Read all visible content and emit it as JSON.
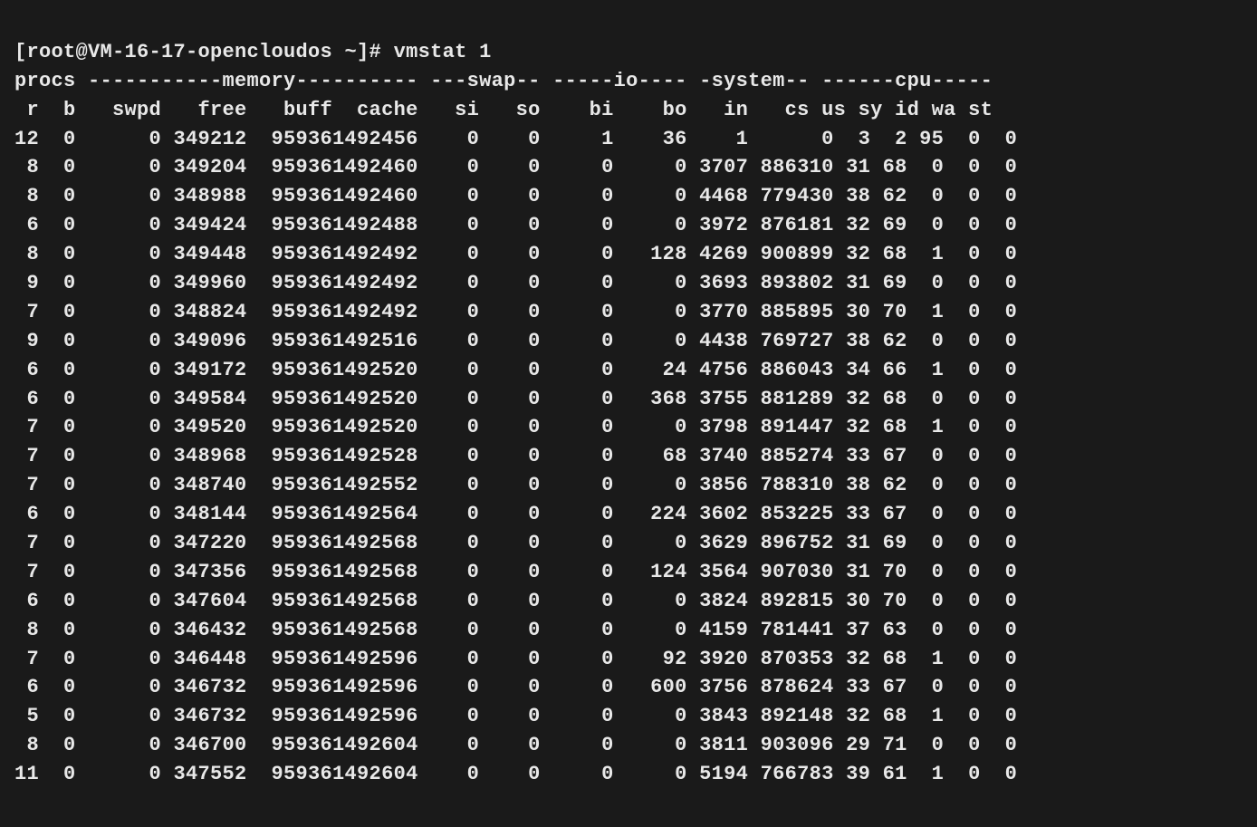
{
  "prompt": "[root@VM-16-17-opencloudos ~]# ",
  "command": "vmstat 1",
  "header1": "procs -----------memory---------- ---swap-- -----io---- -system-- ------cpu-----",
  "header2": " r  b   swpd   free   buff  cache   si   so    bi    bo   in   cs us sy id wa st",
  "rows": [
    {
      "r": "12",
      "b": "0",
      "swpd": "0",
      "free": "349212",
      "buff": "95936",
      "cache": "1492456",
      "si": "0",
      "so": "0",
      "bi": "1",
      "bo": "36",
      "in": "1",
      "cs": "0",
      "us": "3",
      "sy": "2",
      "id": "95",
      "wa": "0",
      "st": "0"
    },
    {
      "r": "8",
      "b": "0",
      "swpd": "0",
      "free": "349204",
      "buff": "95936",
      "cache": "1492460",
      "si": "0",
      "so": "0",
      "bi": "0",
      "bo": "0",
      "in": "3707",
      "cs": "886310",
      "us": "31",
      "sy": "68",
      "id": "0",
      "wa": "0",
      "st": "0"
    },
    {
      "r": "8",
      "b": "0",
      "swpd": "0",
      "free": "348988",
      "buff": "95936",
      "cache": "1492460",
      "si": "0",
      "so": "0",
      "bi": "0",
      "bo": "0",
      "in": "4468",
      "cs": "779430",
      "us": "38",
      "sy": "62",
      "id": "0",
      "wa": "0",
      "st": "0"
    },
    {
      "r": "6",
      "b": "0",
      "swpd": "0",
      "free": "349424",
      "buff": "95936",
      "cache": "1492488",
      "si": "0",
      "so": "0",
      "bi": "0",
      "bo": "0",
      "in": "3972",
      "cs": "876181",
      "us": "32",
      "sy": "69",
      "id": "0",
      "wa": "0",
      "st": "0"
    },
    {
      "r": "8",
      "b": "0",
      "swpd": "0",
      "free": "349448",
      "buff": "95936",
      "cache": "1492492",
      "si": "0",
      "so": "0",
      "bi": "0",
      "bo": "128",
      "in": "4269",
      "cs": "900899",
      "us": "32",
      "sy": "68",
      "id": "1",
      "wa": "0",
      "st": "0"
    },
    {
      "r": "9",
      "b": "0",
      "swpd": "0",
      "free": "349960",
      "buff": "95936",
      "cache": "1492492",
      "si": "0",
      "so": "0",
      "bi": "0",
      "bo": "0",
      "in": "3693",
      "cs": "893802",
      "us": "31",
      "sy": "69",
      "id": "0",
      "wa": "0",
      "st": "0"
    },
    {
      "r": "7",
      "b": "0",
      "swpd": "0",
      "free": "348824",
      "buff": "95936",
      "cache": "1492492",
      "si": "0",
      "so": "0",
      "bi": "0",
      "bo": "0",
      "in": "3770",
      "cs": "885895",
      "us": "30",
      "sy": "70",
      "id": "1",
      "wa": "0",
      "st": "0"
    },
    {
      "r": "9",
      "b": "0",
      "swpd": "0",
      "free": "349096",
      "buff": "95936",
      "cache": "1492516",
      "si": "0",
      "so": "0",
      "bi": "0",
      "bo": "0",
      "in": "4438",
      "cs": "769727",
      "us": "38",
      "sy": "62",
      "id": "0",
      "wa": "0",
      "st": "0"
    },
    {
      "r": "6",
      "b": "0",
      "swpd": "0",
      "free": "349172",
      "buff": "95936",
      "cache": "1492520",
      "si": "0",
      "so": "0",
      "bi": "0",
      "bo": "24",
      "in": "4756",
      "cs": "886043",
      "us": "34",
      "sy": "66",
      "id": "1",
      "wa": "0",
      "st": "0"
    },
    {
      "r": "6",
      "b": "0",
      "swpd": "0",
      "free": "349584",
      "buff": "95936",
      "cache": "1492520",
      "si": "0",
      "so": "0",
      "bi": "0",
      "bo": "368",
      "in": "3755",
      "cs": "881289",
      "us": "32",
      "sy": "68",
      "id": "0",
      "wa": "0",
      "st": "0"
    },
    {
      "r": "7",
      "b": "0",
      "swpd": "0",
      "free": "349520",
      "buff": "95936",
      "cache": "1492520",
      "si": "0",
      "so": "0",
      "bi": "0",
      "bo": "0",
      "in": "3798",
      "cs": "891447",
      "us": "32",
      "sy": "68",
      "id": "1",
      "wa": "0",
      "st": "0"
    },
    {
      "r": "7",
      "b": "0",
      "swpd": "0",
      "free": "348968",
      "buff": "95936",
      "cache": "1492528",
      "si": "0",
      "so": "0",
      "bi": "0",
      "bo": "68",
      "in": "3740",
      "cs": "885274",
      "us": "33",
      "sy": "67",
      "id": "0",
      "wa": "0",
      "st": "0"
    },
    {
      "r": "7",
      "b": "0",
      "swpd": "0",
      "free": "348740",
      "buff": "95936",
      "cache": "1492552",
      "si": "0",
      "so": "0",
      "bi": "0",
      "bo": "0",
      "in": "3856",
      "cs": "788310",
      "us": "38",
      "sy": "62",
      "id": "0",
      "wa": "0",
      "st": "0"
    },
    {
      "r": "6",
      "b": "0",
      "swpd": "0",
      "free": "348144",
      "buff": "95936",
      "cache": "1492564",
      "si": "0",
      "so": "0",
      "bi": "0",
      "bo": "224",
      "in": "3602",
      "cs": "853225",
      "us": "33",
      "sy": "67",
      "id": "0",
      "wa": "0",
      "st": "0"
    },
    {
      "r": "7",
      "b": "0",
      "swpd": "0",
      "free": "347220",
      "buff": "95936",
      "cache": "1492568",
      "si": "0",
      "so": "0",
      "bi": "0",
      "bo": "0",
      "in": "3629",
      "cs": "896752",
      "us": "31",
      "sy": "69",
      "id": "0",
      "wa": "0",
      "st": "0"
    },
    {
      "r": "7",
      "b": "0",
      "swpd": "0",
      "free": "347356",
      "buff": "95936",
      "cache": "1492568",
      "si": "0",
      "so": "0",
      "bi": "0",
      "bo": "124",
      "in": "3564",
      "cs": "907030",
      "us": "31",
      "sy": "70",
      "id": "0",
      "wa": "0",
      "st": "0"
    },
    {
      "r": "6",
      "b": "0",
      "swpd": "0",
      "free": "347604",
      "buff": "95936",
      "cache": "1492568",
      "si": "0",
      "so": "0",
      "bi": "0",
      "bo": "0",
      "in": "3824",
      "cs": "892815",
      "us": "30",
      "sy": "70",
      "id": "0",
      "wa": "0",
      "st": "0"
    },
    {
      "r": "8",
      "b": "0",
      "swpd": "0",
      "free": "346432",
      "buff": "95936",
      "cache": "1492568",
      "si": "0",
      "so": "0",
      "bi": "0",
      "bo": "0",
      "in": "4159",
      "cs": "781441",
      "us": "37",
      "sy": "63",
      "id": "0",
      "wa": "0",
      "st": "0"
    },
    {
      "r": "7",
      "b": "0",
      "swpd": "0",
      "free": "346448",
      "buff": "95936",
      "cache": "1492596",
      "si": "0",
      "so": "0",
      "bi": "0",
      "bo": "92",
      "in": "3920",
      "cs": "870353",
      "us": "32",
      "sy": "68",
      "id": "1",
      "wa": "0",
      "st": "0"
    },
    {
      "r": "6",
      "b": "0",
      "swpd": "0",
      "free": "346732",
      "buff": "95936",
      "cache": "1492596",
      "si": "0",
      "so": "0",
      "bi": "0",
      "bo": "600",
      "in": "3756",
      "cs": "878624",
      "us": "33",
      "sy": "67",
      "id": "0",
      "wa": "0",
      "st": "0"
    },
    {
      "r": "5",
      "b": "0",
      "swpd": "0",
      "free": "346732",
      "buff": "95936",
      "cache": "1492596",
      "si": "0",
      "so": "0",
      "bi": "0",
      "bo": "0",
      "in": "3843",
      "cs": "892148",
      "us": "32",
      "sy": "68",
      "id": "1",
      "wa": "0",
      "st": "0"
    },
    {
      "r": "8",
      "b": "0",
      "swpd": "0",
      "free": "346700",
      "buff": "95936",
      "cache": "1492604",
      "si": "0",
      "so": "0",
      "bi": "0",
      "bo": "0",
      "in": "3811",
      "cs": "903096",
      "us": "29",
      "sy": "71",
      "id": "0",
      "wa": "0",
      "st": "0"
    },
    {
      "r": "11",
      "b": "0",
      "swpd": "0",
      "free": "347552",
      "buff": "95936",
      "cache": "1492604",
      "si": "0",
      "so": "0",
      "bi": "0",
      "bo": "0",
      "in": "5194",
      "cs": "766783",
      "us": "39",
      "sy": "61",
      "id": "1",
      "wa": "0",
      "st": "0"
    }
  ],
  "col_widths": {
    "r": 2,
    "b": 3,
    "swpd": 7,
    "free": 7,
    "buff": 7,
    "cache": 7,
    "si": 5,
    "so": 5,
    "bi": 6,
    "bo": 6,
    "in": 5,
    "cs": 7,
    "us": 3,
    "sy": 3,
    "id": 3,
    "wa": 3,
    "st": 3
  }
}
